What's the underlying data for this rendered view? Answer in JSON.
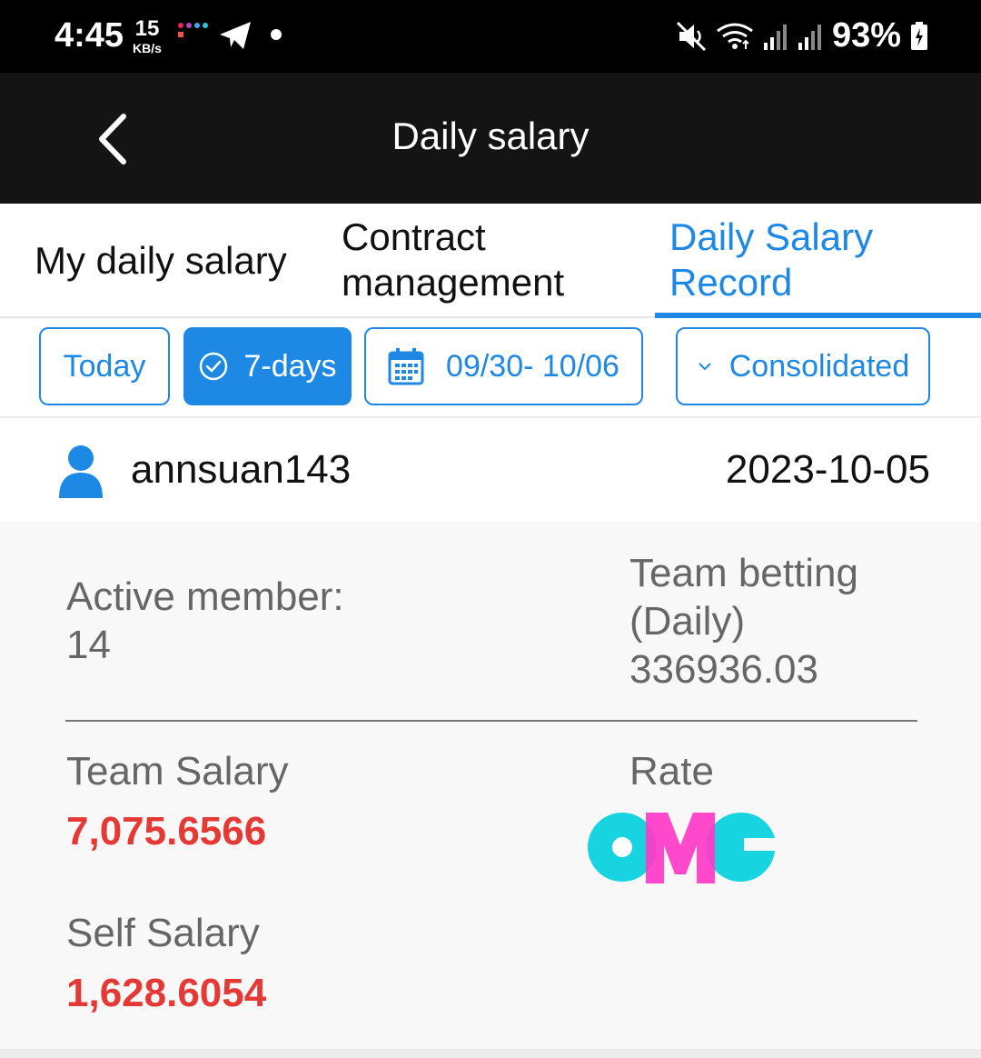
{
  "status_bar": {
    "time": "4:45",
    "speed_value": "15",
    "speed_unit": "KB/s",
    "battery": "93%"
  },
  "app_bar": {
    "title": "Daily salary"
  },
  "tabs": [
    {
      "label": "My daily salary",
      "active": false
    },
    {
      "label": "Contract management",
      "active": false
    },
    {
      "label": "Daily Salary Record",
      "active": true
    }
  ],
  "filters": {
    "today": "Today",
    "seven_days": "7-days",
    "date_range": "09/30- 10/06",
    "consolidated": "Consolidated"
  },
  "record": {
    "username": "annsuan143",
    "date": "2023-10-05",
    "active_member_label": "Active member:",
    "active_member_value": "14",
    "team_betting_label": "Team betting (Daily)",
    "team_betting_value": "336936.03",
    "team_salary_label": "Team Salary",
    "team_salary_value": "7,075.6566",
    "rate_label": "Rate",
    "rate_logo": "OMG",
    "self_salary_label": "Self Salary",
    "self_salary_value": "1,628.6054"
  },
  "colors": {
    "accent": "#1e88e5",
    "amount": "#e53935",
    "header_bg": "#141414"
  }
}
